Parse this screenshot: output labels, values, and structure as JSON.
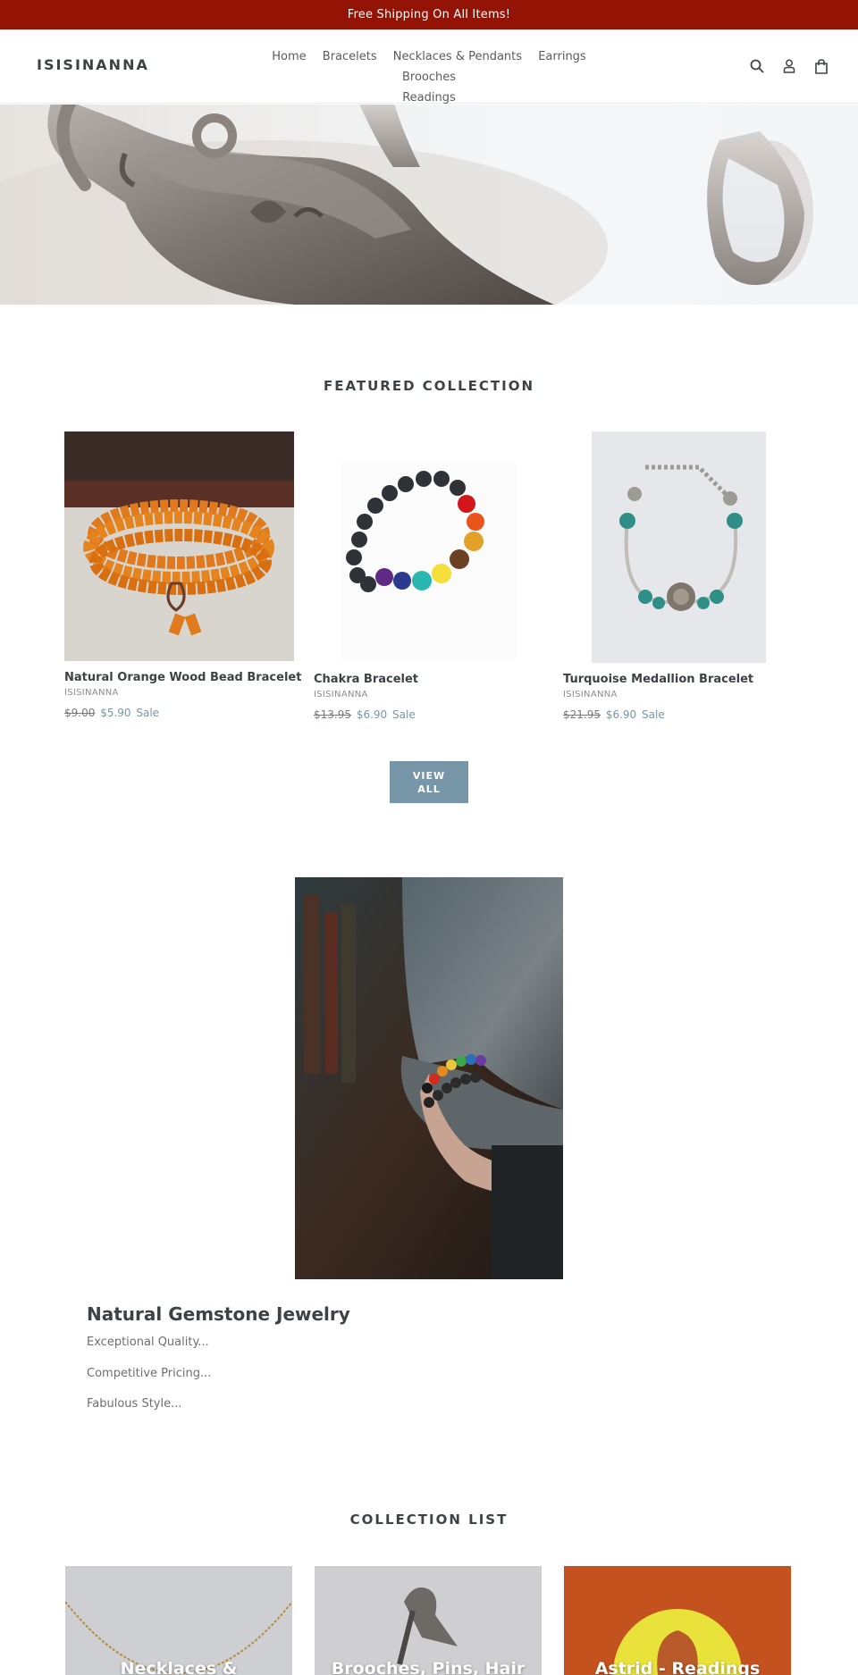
{
  "announcement": {
    "text": "Free Shipping On All Items!"
  },
  "header": {
    "logo": "ISISINANNA",
    "nav": [
      "Home",
      "Bracelets",
      "Necklaces & Pendants",
      "Earrings",
      "Brooches",
      "Readings"
    ],
    "icons": [
      "search-icon",
      "account-icon",
      "cart-icon"
    ]
  },
  "featured": {
    "title": "FEATURED COLLECTION",
    "products": [
      {
        "name": "Natural Orange Wood Bead Bracelet",
        "vendor": "ISISINANNA",
        "old_price": "$9.00",
        "new_price": "$5.90",
        "sale": "Sale"
      },
      {
        "name": "Chakra Bracelet",
        "vendor": "ISISINANNA",
        "old_price": "$13.95",
        "new_price": "$6.90",
        "sale": "Sale"
      },
      {
        "name": "Turquoise Medallion Bracelet",
        "vendor": "ISISINANNA",
        "old_price": "$21.95",
        "new_price": "$6.90",
        "sale": "Sale"
      }
    ],
    "view_all": "VIEW ALL"
  },
  "gem": {
    "heading": "Natural Gemstone Jewelry",
    "lines": [
      "Exceptional Quality...",
      "Competitive Pricing...",
      "Fabulous Style..."
    ]
  },
  "collections": {
    "title": "COLLECTION LIST",
    "items": [
      "Necklaces &",
      "Brooches, Pins, Hair",
      "Astrid - Readings"
    ]
  },
  "colors": {
    "announcement_bg": "#931305",
    "accent": "#7796a8",
    "text": "#3d4246"
  }
}
